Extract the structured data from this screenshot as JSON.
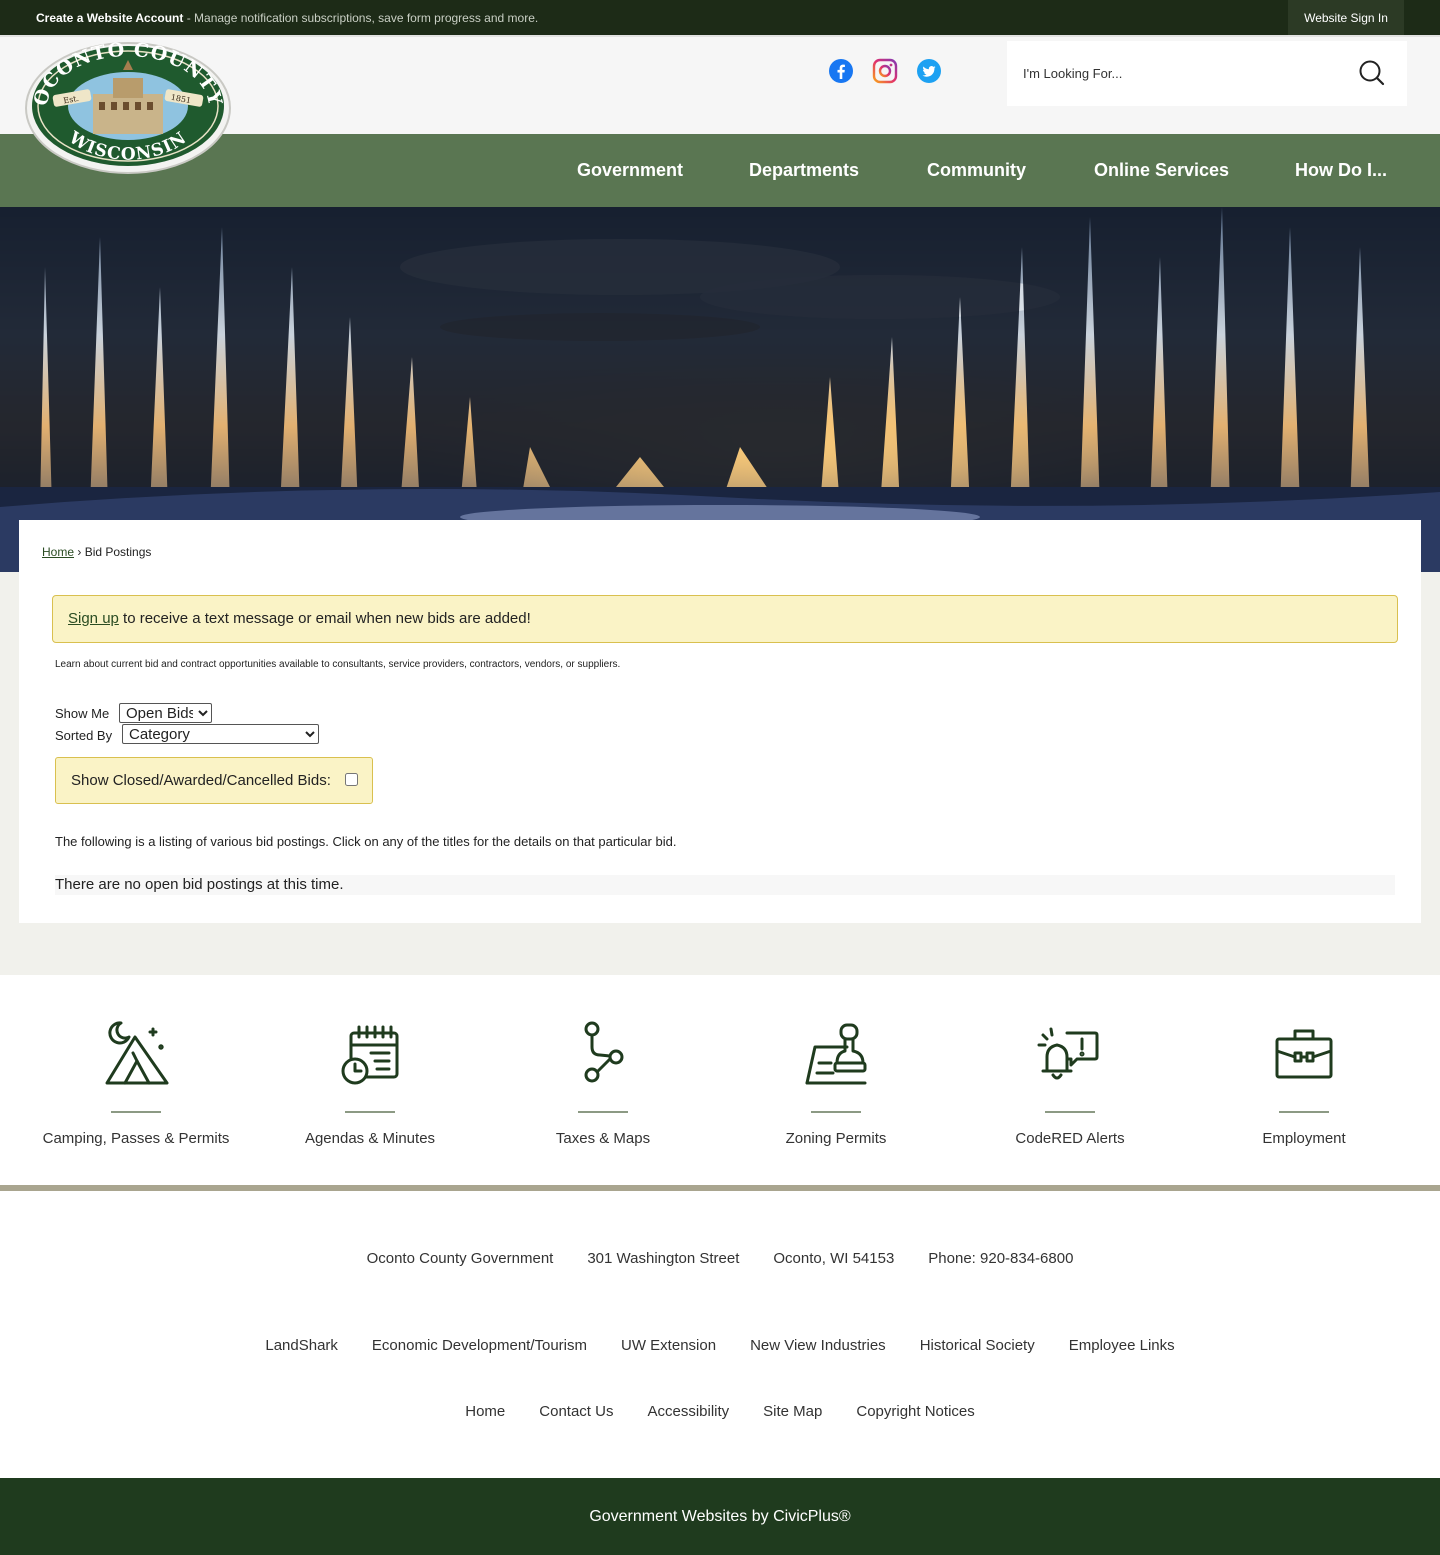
{
  "topbar": {
    "create_label": "Create a Website Account",
    "create_desc": " - Manage notification subscriptions, save form progress and more.",
    "signin_label": "Website Sign In"
  },
  "header": {
    "logo_text_top": "OCONTO COUNTY",
    "logo_text_bottom": "WISCONSIN",
    "logo_est": "Est.",
    "logo_year": "1851",
    "search_placeholder": "I'm Looking For..."
  },
  "nav": [
    "Government",
    "Departments",
    "Community",
    "Online Services",
    "How Do I..."
  ],
  "breadcrumb": {
    "home": "Home",
    "sep": " › ",
    "current": "Bid Postings"
  },
  "notice": {
    "link": "Sign up",
    "text": " to receive a text message or email when new bids are added!"
  },
  "intro": "Learn about current bid and contract opportunities available to consultants, service providers, contractors, vendors, or suppliers.",
  "filters": {
    "show_me_label": "Show Me",
    "show_me_value": "Open Bids",
    "sorted_by_label": "Sorted By",
    "sorted_by_value": "Category",
    "closed_label": "Show Closed/Awarded/Cancelled Bids:"
  },
  "listing_text": "The following is a listing of various bid postings. Click on any of the titles for the details on that particular bid.",
  "no_bids": "There are no open bid postings at this time.",
  "quick_links": [
    {
      "label": "Camping, Passes & Permits",
      "icon": "tent-icon"
    },
    {
      "label": "Agendas & Minutes",
      "icon": "calendar-icon"
    },
    {
      "label": "Taxes & Maps",
      "icon": "map-route-icon"
    },
    {
      "label": "Zoning Permits",
      "icon": "stamp-icon"
    },
    {
      "label": "CodeRED Alerts",
      "icon": "alert-bell-icon"
    },
    {
      "label": "Employment",
      "icon": "briefcase-icon"
    }
  ],
  "footer": {
    "contact": [
      "Oconto County Government",
      "301 Washington Street",
      "Oconto, WI 54153",
      "Phone: 920-834-6800"
    ],
    "partners": [
      "LandShark",
      "Economic Development/Tourism",
      "UW Extension",
      "New View Industries",
      "Historical Society",
      "Employee Links"
    ],
    "links": [
      "Home",
      "Contact Us",
      "Accessibility",
      "Site Map",
      "Copyright Notices"
    ],
    "credit": "Government Websites by CivicPlus®"
  },
  "colors": {
    "topbar": "#1d2b17",
    "nav": "#5a7652",
    "footer_bottom": "#1f3b1e",
    "notice_bg": "#faf3c6",
    "icon_green": "#1f3b1e"
  }
}
